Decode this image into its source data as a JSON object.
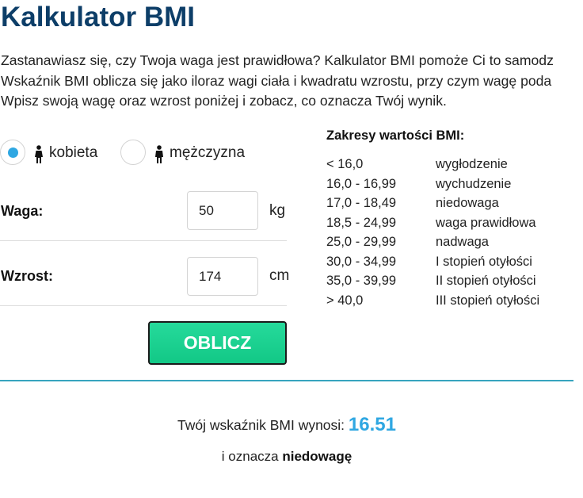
{
  "page": {
    "title": "Kalkulator BMI",
    "intro": [
      "Zastanawiasz się, czy Twoja waga jest prawidłowa? Kalkulator BMI pomoże Ci to samodz",
      "Wskaźnik BMI oblicza się jako iloraz wagi ciała i kwadratu wzrostu, przy czym wagę poda",
      "Wpisz swoją wagę oraz wzrost poniżej i zobacz, co oznacza Twój wynik."
    ]
  },
  "form": {
    "gender": {
      "female_label": "kobieta",
      "male_label": "mężczyzna",
      "selected": "kobieta"
    },
    "weight": {
      "label": "Waga:",
      "value": "50",
      "unit": "kg"
    },
    "height": {
      "label": "Wzrost:",
      "value": "174",
      "unit": "cm"
    },
    "calculate_label": "OBLICZ"
  },
  "ranges": {
    "title": "Zakresy wartości BMI:",
    "items": [
      {
        "range": "< 16,0",
        "desc": "wygłodzenie"
      },
      {
        "range": "16,0 - 16,99",
        "desc": "wychudzenie"
      },
      {
        "range": "17,0 - 18,49",
        "desc": "niedowaga"
      },
      {
        "range": "18,5 - 24,99",
        "desc": "waga prawidłowa"
      },
      {
        "range": "25,0 - 29,99",
        "desc": "nadwaga"
      },
      {
        "range": "30,0 - 34,99",
        "desc": "I stopień otyłości"
      },
      {
        "range": "35,0 - 39,99",
        "desc": "II stopień otyłości"
      },
      {
        "range": "> 40,0",
        "desc": "III stopień otyłości"
      }
    ]
  },
  "result": {
    "prefix": "Twój wskaźnik BMI wynosi:",
    "value": "16.51",
    "meaning_prefix": "i oznacza",
    "category": "niedowagę"
  },
  "colors": {
    "title": "#0d3e68",
    "accent": "#2fa7e2",
    "button": "#1ccf8f",
    "separator": "#37a4be"
  },
  "icons": {
    "female": "person-icon",
    "male": "person-icon"
  }
}
